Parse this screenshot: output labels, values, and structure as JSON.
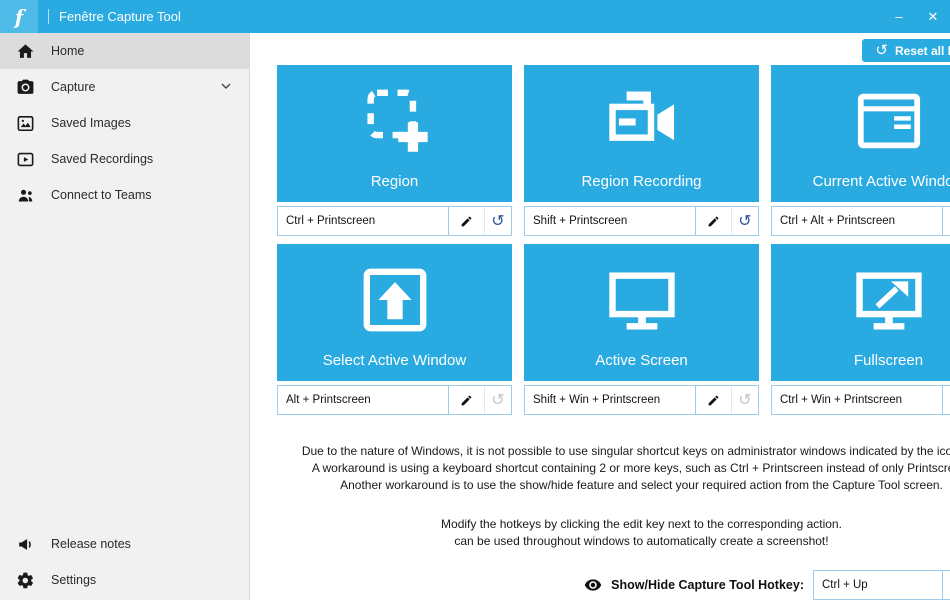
{
  "app": {
    "logo_letter": "f",
    "title": "Fenêtre Capture Tool"
  },
  "icons": {
    "reset": "↺",
    "minimize": "–",
    "close": "✕"
  },
  "colors": {
    "accent": "#29ABE2",
    "sidebar_bg": "#F1F1F1",
    "selected_item_bg": "#DCDCDC",
    "hotkey_border": "#9ECDEB"
  },
  "sidebar": {
    "items": [
      {
        "label": "Home"
      },
      {
        "label": "Capture"
      },
      {
        "label": "Saved Images"
      },
      {
        "label": "Saved Recordings"
      },
      {
        "label": "Connect to Teams"
      }
    ],
    "footer_items": [
      {
        "label": "Release notes"
      },
      {
        "label": "Settings"
      }
    ]
  },
  "main": {
    "reset_all_label": "Reset all hotkeys",
    "tiles": [
      {
        "label": "Region",
        "hotkey": "Ctrl + Printscreen",
        "reset_enabled": true
      },
      {
        "label": "Region Recording",
        "hotkey": "Shift + Printscreen",
        "reset_enabled": true
      },
      {
        "label": "Current Active Window",
        "hotkey": "Ctrl + Alt + Printscreen",
        "reset_enabled": true
      },
      {
        "label": "Select Active Window",
        "hotkey": "Alt + Printscreen",
        "reset_enabled": false
      },
      {
        "label": "Active Screen",
        "hotkey": "Shift + Win + Printscreen",
        "reset_enabled": false
      },
      {
        "label": "Fullscreen",
        "hotkey": "Ctrl + Win + Printscreen",
        "reset_enabled": false
      }
    ],
    "notes": [
      "Due to the nature of Windows, it is not possible to use singular shortcut keys on administrator windows indicated by the icon:",
      "A workaround is using a keyboard shortcut containing 2 or more keys, such as Ctrl + Printscreen instead of only Printscreen.",
      "Another workaround is to use the show/hide feature and select your required action from the Capture Tool screen."
    ],
    "notes2": [
      "Modify the hotkeys by clicking the edit key next to the corresponding action.",
      "can be used throughout windows to automatically create a screenshot!"
    ],
    "showhide": {
      "label": "Show/Hide Capture Tool Hotkey:",
      "hotkey": "Ctrl + Up"
    }
  }
}
